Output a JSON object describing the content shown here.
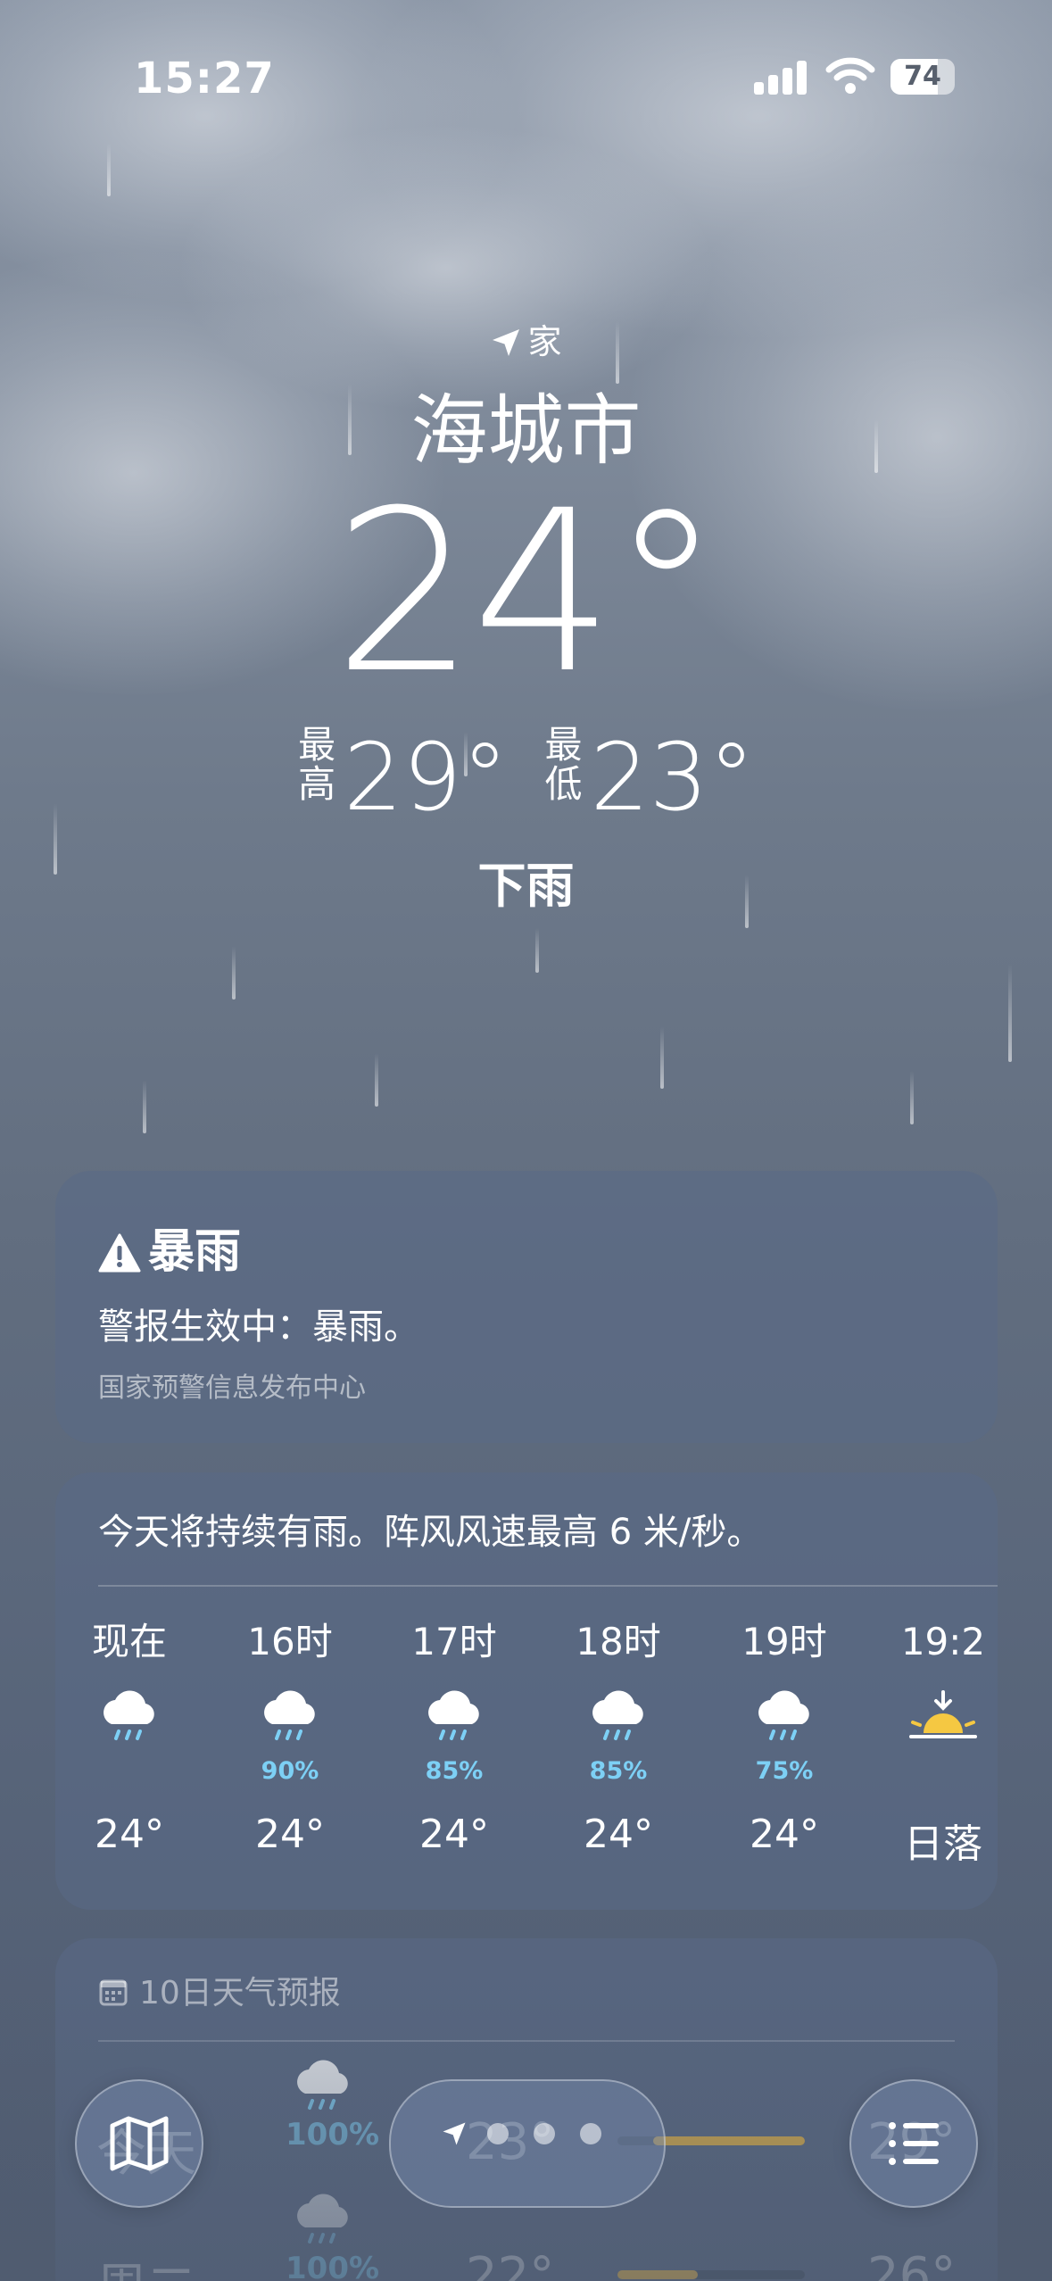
{
  "status_bar": {
    "time": "15:27",
    "battery": "74",
    "battery_level": 0.74,
    "icons": [
      "cellular-signal-icon",
      "wifi-icon",
      "battery-icon"
    ]
  },
  "header": {
    "location_label": "家",
    "city": "海城市",
    "current_temp": "24°",
    "high_label": "最高",
    "high": "29°",
    "low_label": "最低",
    "low": "23°",
    "condition": "下雨"
  },
  "alert": {
    "title": "暴雨",
    "body": "警报生效中：暴雨。",
    "source": "国家预警信息发布中心",
    "icon": "warning-triangle-icon"
  },
  "hourly": {
    "summary": "今天将持续有雨。阵风风速最高 6 米/秒。",
    "items": [
      {
        "label": "现在",
        "icon": "rain-cloud-icon",
        "pct": "",
        "temp": "24°"
      },
      {
        "label": "16时",
        "icon": "rain-cloud-icon",
        "pct": "90%",
        "temp": "24°"
      },
      {
        "label": "17时",
        "icon": "rain-cloud-icon",
        "pct": "85%",
        "temp": "24°"
      },
      {
        "label": "18时",
        "icon": "rain-cloud-icon",
        "pct": "85%",
        "temp": "24°"
      },
      {
        "label": "19时",
        "icon": "rain-cloud-icon",
        "pct": "75%",
        "temp": "24°"
      },
      {
        "label": "19:2",
        "icon": "sunset-icon",
        "pct": "",
        "temp": "日落"
      }
    ]
  },
  "forecast": {
    "title": "10日天气预报",
    "rows": [
      {
        "day": "今天",
        "icon": "rain-cloud-icon",
        "pct": "100%",
        "low": "23°",
        "high": "29°"
      },
      {
        "day": "周二",
        "icon": "rain-cloud-icon",
        "pct": "100%",
        "low": "22°",
        "high": "26°"
      }
    ]
  },
  "toolbar": {
    "map": "map-icon",
    "pager": "page-indicator",
    "list": "list-icon"
  }
}
